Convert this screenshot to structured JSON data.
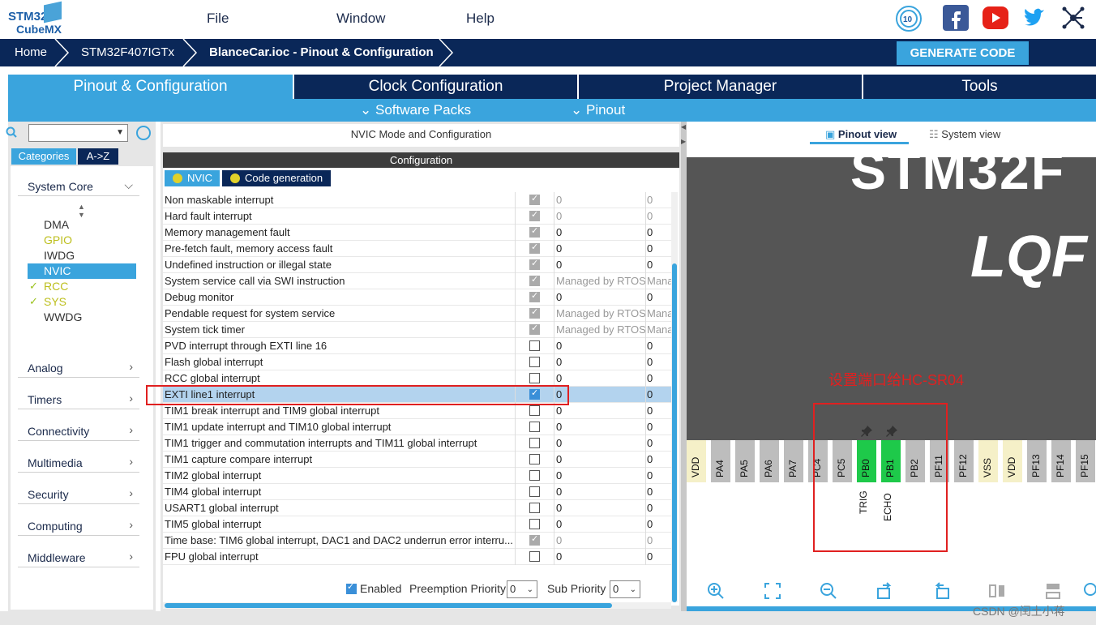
{
  "app": {
    "logo_line1": "STM32",
    "logo_line2": "CubeMX"
  },
  "menu": {
    "file": "File",
    "window": "Window",
    "help": "Help"
  },
  "breadcrumb": {
    "home": "Home",
    "mcu": "STM32F407IGTx",
    "project": "BlanceCar.ioc - Pinout & Configuration"
  },
  "generate_button": "GENERATE CODE",
  "main_tabs": {
    "pinout": "Pinout & Configuration",
    "clock": "Clock Configuration",
    "project": "Project Manager",
    "tools": "Tools"
  },
  "sub_tabs": {
    "software_packs": "Software Packs",
    "pinout": "Pinout"
  },
  "left": {
    "categories_tab": "Categories",
    "az_tab": "A->Z",
    "system_core": "System Core",
    "items": [
      "DMA",
      "GPIO",
      "IWDG",
      "NVIC",
      "RCC",
      "SYS",
      "WWDG"
    ],
    "sections": [
      "Analog",
      "Timers",
      "Connectivity",
      "Multimedia",
      "Security",
      "Computing",
      "Middleware"
    ]
  },
  "mid": {
    "title": "NVIC Mode and Configuration",
    "config_head": "Configuration",
    "tab_nvic": "NVIC",
    "tab_codegen": "Code generation",
    "rows": [
      {
        "name": "Non maskable interrupt",
        "p1": "0",
        "p2": "0"
      },
      {
        "name": "Hard fault interrupt",
        "p1": "0",
        "p2": "0"
      },
      {
        "name": "Memory management fault",
        "p1": "0",
        "p2": "0"
      },
      {
        "name": "Pre-fetch fault, memory access fault",
        "p1": "0",
        "p2": "0"
      },
      {
        "name": "Undefined instruction or illegal state",
        "p1": "0",
        "p2": "0"
      },
      {
        "name": "System service call via SWI instruction",
        "p1": "Managed by RTOS",
        "p2": "Mana"
      },
      {
        "name": "Debug monitor",
        "p1": "0",
        "p2": "0"
      },
      {
        "name": "Pendable request for system service",
        "p1": "Managed by RTOS",
        "p2": "Mana"
      },
      {
        "name": "System tick timer",
        "p1": "Managed by RTOS",
        "p2": "Mana"
      },
      {
        "name": "PVD interrupt through EXTI line 16",
        "p1": "0",
        "p2": "0"
      },
      {
        "name": "Flash global interrupt",
        "p1": "0",
        "p2": "0"
      },
      {
        "name": "RCC global interrupt",
        "p1": "0",
        "p2": "0"
      },
      {
        "name": "EXTI line1 interrupt",
        "p1": "0",
        "p2": "0"
      },
      {
        "name": "TIM1 break interrupt and TIM9 global interrupt",
        "p1": "0",
        "p2": "0"
      },
      {
        "name": "TIM1 update interrupt and TIM10 global interrupt",
        "p1": "0",
        "p2": "0"
      },
      {
        "name": "TIM1 trigger and commutation interrupts and TIM11 global interrupt",
        "p1": "0",
        "p2": "0"
      },
      {
        "name": "TIM1 capture compare interrupt",
        "p1": "0",
        "p2": "0"
      },
      {
        "name": "TIM2 global interrupt",
        "p1": "0",
        "p2": "0"
      },
      {
        "name": "TIM4 global interrupt",
        "p1": "0",
        "p2": "0"
      },
      {
        "name": "USART1 global interrupt",
        "p1": "0",
        "p2": "0"
      },
      {
        "name": "TIM5 global interrupt",
        "p1": "0",
        "p2": "0"
      },
      {
        "name": "Time base: TIM6 global interrupt, DAC1 and DAC2 underrun error interru...",
        "p1": "0",
        "p2": "0"
      },
      {
        "name": "FPU global interrupt",
        "p1": "0",
        "p2": "0"
      }
    ],
    "enabled_label": "Enabled",
    "preemption_label": "Preemption Priority",
    "preemption_value": "0",
    "sub_label": "Sub Priority",
    "sub_value": "0"
  },
  "right": {
    "pinout_view": "Pinout view",
    "system_view": "System view",
    "chip_text1": "STM32F",
    "chip_text2": "LQF",
    "pins": [
      "VDD",
      "PA4",
      "PA5",
      "PA6",
      "PA7",
      "PC4",
      "PC5",
      "PB0",
      "PB1",
      "PB2",
      "PF11",
      "PF12",
      "VSS",
      "VDD",
      "PF13",
      "PF14",
      "PF15"
    ],
    "sig_trig": "TRIG",
    "sig_echo": "ECHO",
    "annotation": "设置端口给HC-SR04"
  },
  "watermark": "CSDN @闰土小蒋"
}
